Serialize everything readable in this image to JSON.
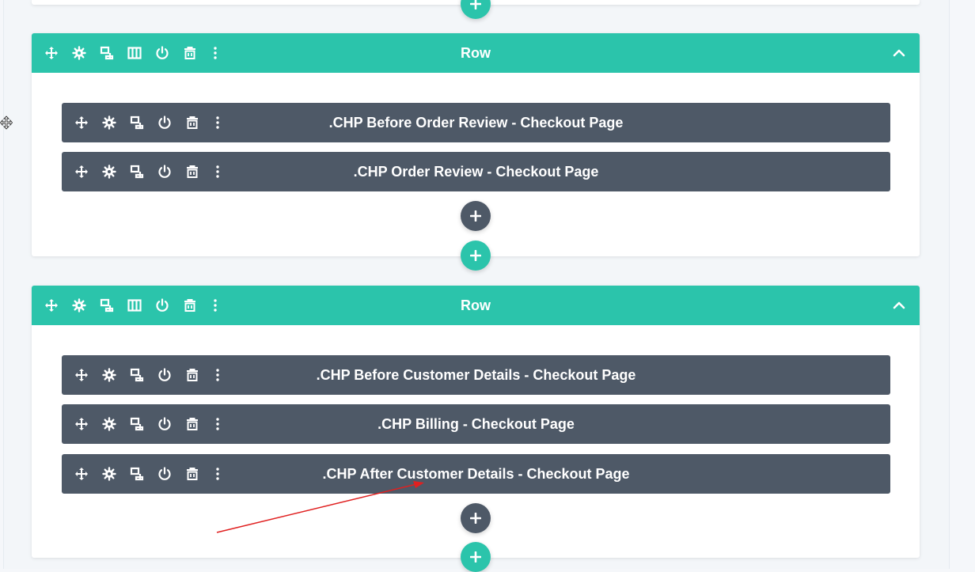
{
  "colors": {
    "row_header": "#2bc4ab",
    "module_bar": "#4e5967",
    "add_green": "#2bc4ab",
    "add_dark": "#4e5967",
    "annotation_arrow": "#e02020"
  },
  "row_toolbar_icons": [
    "move-icon",
    "gear-icon",
    "duplicate-icon",
    "columns-icon",
    "power-icon",
    "trash-icon",
    "more-icon"
  ],
  "module_toolbar_icons": [
    "move-icon",
    "gear-icon",
    "duplicate-icon",
    "power-icon",
    "trash-icon",
    "more-icon"
  ],
  "rows": [
    {
      "title": "Row",
      "modules": [
        {
          "title": ".CHP Before Order Review - Checkout Page"
        },
        {
          "title": ".CHP Order Review - Checkout Page"
        }
      ]
    },
    {
      "title": "Row",
      "modules": [
        {
          "title": ".CHP Before Customer Details - Checkout Page"
        },
        {
          "title": ".CHP Billing - Checkout Page"
        },
        {
          "title": ".CHP After Customer Details - Checkout Page"
        }
      ]
    }
  ]
}
